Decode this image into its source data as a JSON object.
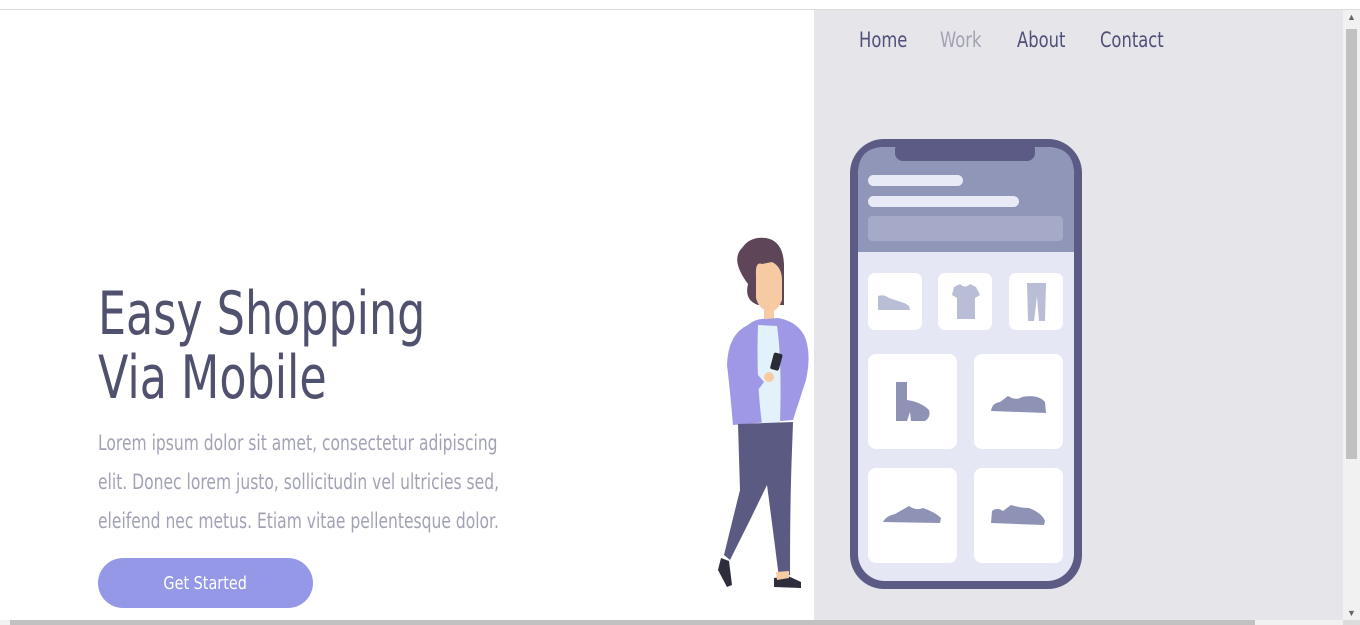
{
  "nav": {
    "items": [
      {
        "label": "Home"
      },
      {
        "label": "Work"
      },
      {
        "label": "About"
      },
      {
        "label": "Contact"
      }
    ]
  },
  "hero": {
    "title_line1": "Easy Shopping",
    "title_line2": "Via Mobile",
    "description": "Lorem ipsum dolor sit amet, consectetur adipiscing elit. Donec lorem justo, sollicitudin vel ultricies sed, eleifend nec metus. Etiam vitae pellentesque dolor.",
    "cta_label": "Get Started"
  },
  "colors": {
    "accent": "#9598e6",
    "heading": "#50506f",
    "muted_text": "#a2a2b6",
    "panel_bg": "#e5e5ea"
  }
}
